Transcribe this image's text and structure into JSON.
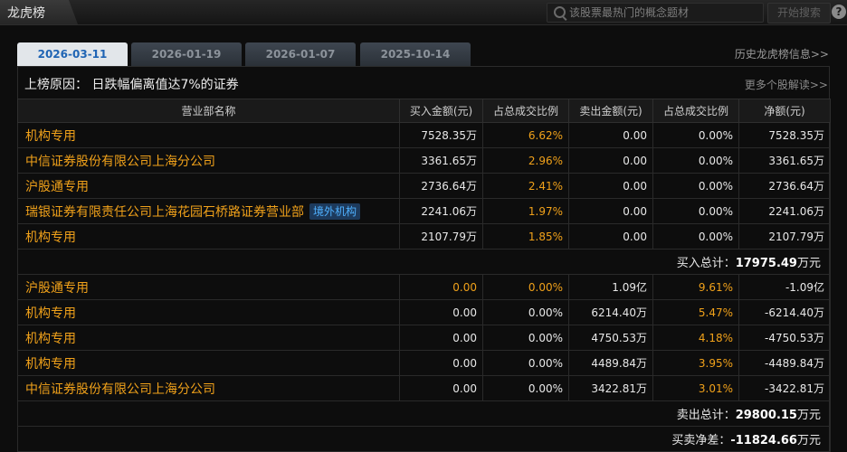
{
  "app": {
    "title": "龙虎榜"
  },
  "search": {
    "placeholder": "该股票最热门的概念题材",
    "button": "开始搜索",
    "help": "?"
  },
  "tabs": [
    {
      "label": "2026-03-11",
      "active": true
    },
    {
      "label": "2026-01-19",
      "active": false
    },
    {
      "label": "2026-01-07",
      "active": false
    },
    {
      "label": "2025-10-14",
      "active": false
    }
  ],
  "history_link": "历史龙虎榜信息>>",
  "reason": "上榜原因：   日跌幅偏离值达7%的证券",
  "more_link": "更多个股解读>>",
  "columns": [
    "营业部名称",
    "买入金额(元)",
    "占总成交比例",
    "卖出金额(元)",
    "占总成交比例",
    "净额(元)"
  ],
  "buy_rows": [
    {
      "name": "机构专用",
      "buy": "7528.35万",
      "buy_pct": "6.62%",
      "sell": "0.00",
      "sell_pct": "0.00%",
      "net": "7528.35万"
    },
    {
      "name": "中信证券股份有限公司上海分公司",
      "buy": "3361.65万",
      "buy_pct": "2.96%",
      "sell": "0.00",
      "sell_pct": "0.00%",
      "net": "3361.65万"
    },
    {
      "name": "沪股通专用",
      "buy": "2736.64万",
      "buy_pct": "2.41%",
      "sell": "0.00",
      "sell_pct": "0.00%",
      "net": "2736.64万"
    },
    {
      "name": "瑞银证券有限责任公司上海花园石桥路证券营业部",
      "badge": "境外机构",
      "buy": "2241.06万",
      "buy_pct": "1.97%",
      "sell": "0.00",
      "sell_pct": "0.00%",
      "net": "2241.06万"
    },
    {
      "name": "机构专用",
      "buy": "2107.79万",
      "buy_pct": "1.85%",
      "sell": "0.00",
      "sell_pct": "0.00%",
      "net": "2107.79万"
    }
  ],
  "buy_total": {
    "label": "买入总计：",
    "value": "17975.49",
    "unit": "万元"
  },
  "sell_rows": [
    {
      "name": "沪股通专用",
      "buy": "0.00",
      "buy_pct": "0.00%",
      "sell": "1.09亿",
      "sell_pct": "9.61%",
      "net": "-1.09亿"
    },
    {
      "name": "机构专用",
      "buy": "0.00",
      "buy_pct": "0.00%",
      "sell": "6214.40万",
      "sell_pct": "5.47%",
      "net": "-6214.40万"
    },
    {
      "name": "机构专用",
      "buy": "0.00",
      "buy_pct": "0.00%",
      "sell": "4750.53万",
      "sell_pct": "4.18%",
      "net": "-4750.53万"
    },
    {
      "name": "机构专用",
      "buy": "0.00",
      "buy_pct": "0.00%",
      "sell": "4489.84万",
      "sell_pct": "3.95%",
      "net": "-4489.84万"
    },
    {
      "name": "中信证券股份有限公司上海分公司",
      "buy": "0.00",
      "buy_pct": "0.00%",
      "sell": "3422.81万",
      "sell_pct": "3.01%",
      "net": "-3422.81万"
    }
  ],
  "sell_total": {
    "label": "卖出总计：",
    "value": "29800.15",
    "unit": "万元"
  },
  "net_total": {
    "label": "买卖净差：",
    "value": "-11824.66",
    "unit": "万元"
  },
  "colors": {
    "accent": "#f0a11a",
    "active_tab_text": "#1f64b4",
    "badge_text": "#4fb1ff",
    "background": "#0d0d0d"
  }
}
